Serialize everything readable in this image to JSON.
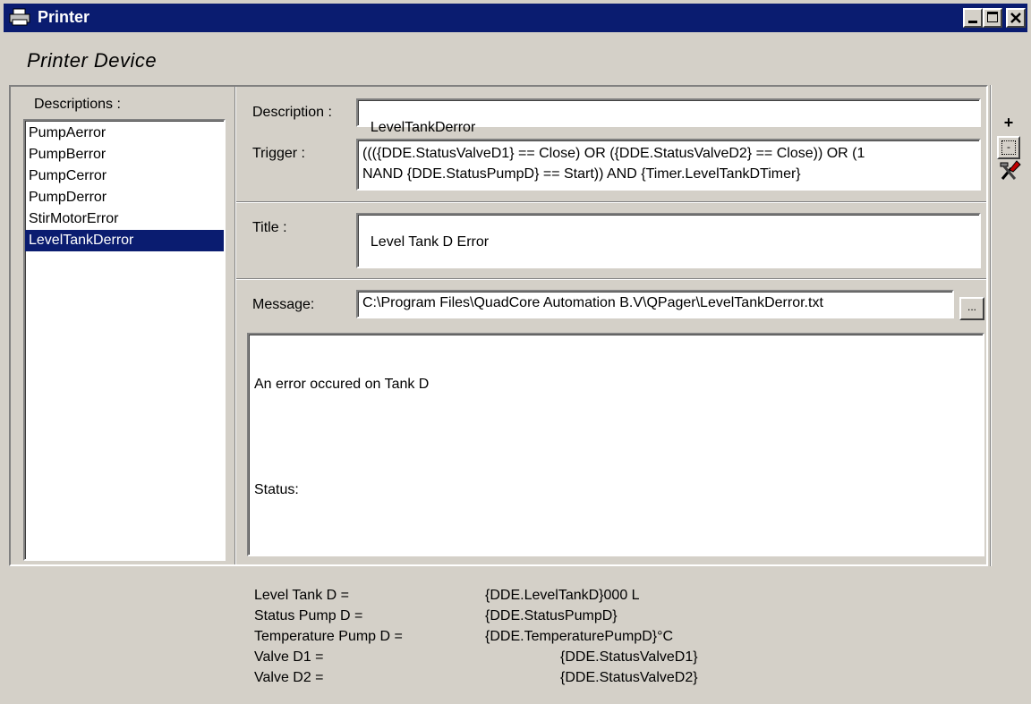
{
  "window": {
    "title": "Printer"
  },
  "section": {
    "heading": "Printer Device"
  },
  "descriptions": {
    "label": "Descriptions :",
    "items": [
      "PumpAerror",
      "PumpBerror",
      "PumpCerror",
      "PumpDerror",
      "StirMotorError",
      "LevelTankDerror"
    ],
    "selected_index": 5
  },
  "form": {
    "description_label": "Description :",
    "description_value": "LevelTankDerror",
    "trigger_label": "Trigger :",
    "trigger_value_line1": "((({DDE.StatusValveD1} == Close) OR ({DDE.StatusValveD2} == Close)) OR (1",
    "trigger_value_line2": "NAND {DDE.StatusPumpD} == Start)) AND {Timer.LevelTankDTimer}",
    "title_label": "Title :",
    "title_value": "Level Tank D Error",
    "message_label": "Message:",
    "message_path": "C:\\Program Files\\QuadCore Automation B.V\\QPager\\LevelTankDerror.txt",
    "browse_label": "..."
  },
  "message_body": {
    "line1": "An error occured on Tank D",
    "line2": "Status:",
    "rows": [
      {
        "name": "Level Tank D =",
        "value": "{DDE.LevelTankD}000 L"
      },
      {
        "name": "Status Pump D =",
        "value": "{DDE.StatusPumpD}"
      },
      {
        "name": "Temperature Pump D =",
        "value": "{DDE.TemperaturePumpD}°C"
      },
      {
        "name": "Valve D1 =",
        "value": "{DDE.StatusValveD1}"
      },
      {
        "name": "Valve D2 =",
        "value": "{DDE.StatusValveD2}"
      }
    ]
  },
  "toolbar": {
    "add_label": "+",
    "remove_label": "-"
  }
}
